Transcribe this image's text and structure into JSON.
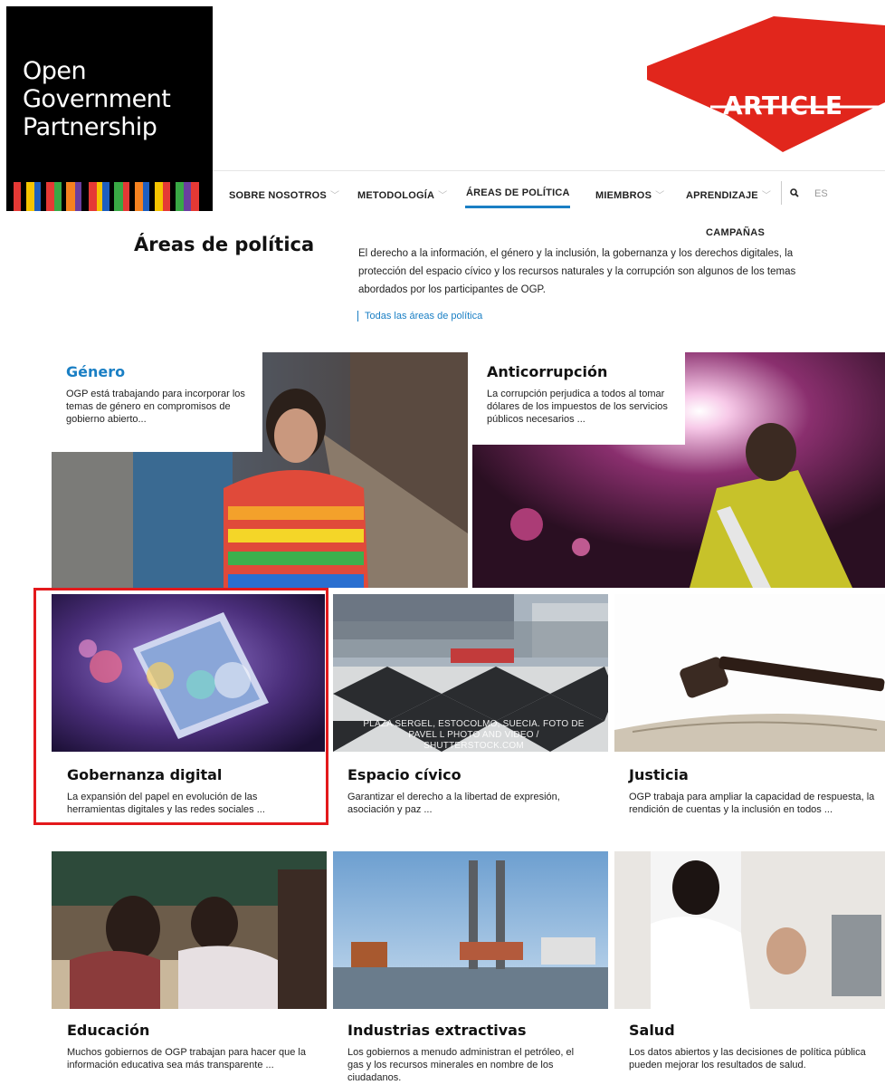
{
  "logo": {
    "lines": [
      "Open",
      "Government",
      "Partnership"
    ]
  },
  "partner": {
    "name": "ARTICLE 19",
    "short": "ARTICLE"
  },
  "nav": {
    "items": [
      {
        "label": "SOBRE NOSOTROS"
      },
      {
        "label": "METODOLOGÍA"
      },
      {
        "label": "ÁREAS DE POLÍTICA"
      },
      {
        "label": "MIEMBROS"
      },
      {
        "label": "APRENDIZAJE"
      }
    ],
    "secondary": "CAMPAÑAS",
    "lang": "ES"
  },
  "intro": {
    "title": "Áreas de política",
    "text": "El derecho a la información, el género y la inclusión, la gobernanza y los derechos digitales, la protección del espacio cívico y los recursos naturales y la corrupción son algunos de los temas abordados por los participantes de OGP.",
    "link": "Todas las áreas de política"
  },
  "cards": {
    "genero": {
      "title": "Género",
      "desc": "OGP está trabajando para incorporar los temas de género en compromisos de gobierno abierto..."
    },
    "anticorrupcion": {
      "title": "Anticorrupción",
      "desc": "La corrupción perjudica a todos al tomar dólares de los impuestos de los servicios públicos necesarios ..."
    },
    "gobernanza": {
      "title": "Gobernanza digital",
      "desc": "La expansión del papel en evolución de las herramientas digitales y las redes sociales ..."
    },
    "civico": {
      "title": "Espacio cívico",
      "desc": "Garantizar el derecho a la libertad de expresión, asociación y paz ...",
      "caption": "PLAZA SERGEL, ESTOCOLMO, SUECIA. FOTO DE PAVEL L PHOTO AND VIDEO / SHUTTERSTOCK.COM"
    },
    "justicia": {
      "title": "Justicia",
      "desc": "OGP trabaja para ampliar la capacidad de respuesta, la rendición de cuentas y la inclusión en todos ..."
    },
    "educacion": {
      "title": "Educación",
      "desc": "Muchos gobiernos de OGP trabajan para hacer que la información educativa sea más transparente ..."
    },
    "extractivas": {
      "title": "Industrias extractivas",
      "desc": "Los gobiernos a menudo administran el petróleo, el gas y los recursos minerales en nombre de los ciudadanos."
    },
    "salud": {
      "title": "Salud",
      "desc": "Los datos abiertos y las decisiones de política pública pueden mejorar los resultados de salud."
    }
  },
  "colors": {
    "accent": "#1a7fc4",
    "highlight": "#e3191c",
    "article_red": "#e1261c"
  }
}
